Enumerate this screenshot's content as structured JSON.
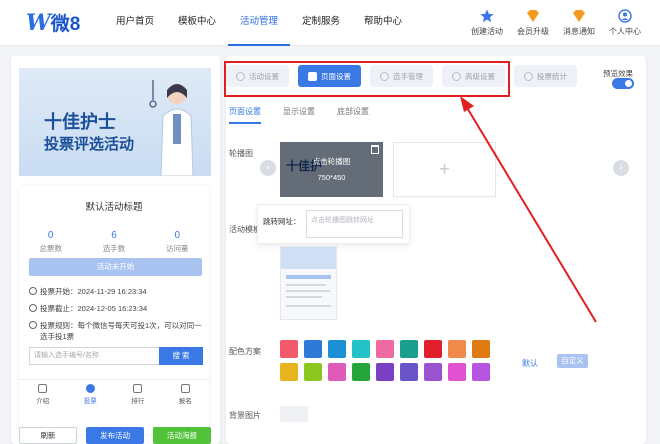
{
  "logo": {
    "text": "微8",
    "mark": "W"
  },
  "nav": {
    "items": [
      "用户首页",
      "模板中心",
      "活动管理",
      "定制服务",
      "帮助中心"
    ],
    "active": 2
  },
  "tools": [
    {
      "label": "创建活动",
      "icon": "star-icon",
      "color": "#3a78e6"
    },
    {
      "label": "会员升级",
      "icon": "vip-icon",
      "color": "#f39a1f"
    },
    {
      "label": "消息通知",
      "icon": "bell-icon",
      "color": "#f39a1f"
    },
    {
      "label": "个人中心",
      "icon": "user-icon",
      "color": "#3a78e6"
    }
  ],
  "preview": {
    "banner_line1": "十佳护士",
    "banner_line2": "投票评选活动",
    "title": "默认活动标题",
    "stats": [
      {
        "num": "0",
        "label": "总票数"
      },
      {
        "num": "6",
        "label": "选手数"
      },
      {
        "num": "0",
        "label": "访问量"
      }
    ],
    "status": "活动未开始",
    "info": [
      "投票开始：2024-11-29 16:23:34",
      "投票截止：2024-12-05 16:23:34",
      "投票规则：每个微信号每天可投1次，可以对同一选手投1票"
    ],
    "search_placeholder": "请输入选手编号/名称",
    "search_btn": "搜 索",
    "tabs": [
      "介绍",
      "投票",
      "排行",
      "报名"
    ],
    "active_tab": 1,
    "bottom_buttons": [
      "刷新",
      "发布活动",
      "活动海报"
    ]
  },
  "editor": {
    "steps": [
      "活动设置",
      "页面设置",
      "选手管理",
      "高级设置",
      "投票统计"
    ],
    "active_step": 1,
    "preview_toggle_label": "预览效果",
    "preview_toggle_on": true,
    "subtabs": [
      "页面设置",
      "显示设置",
      "底部设置"
    ],
    "active_subtab": 0,
    "labels": {
      "carousel": "轮播图",
      "activity_mode": "活动模板",
      "color_scheme": "配色方案",
      "bg_image": "背景图片"
    },
    "slide": {
      "title": "十佳护",
      "overlay_text": "点击轮播图",
      "size": "750*450"
    },
    "link": {
      "label": "跳转网址：",
      "placeholder": "点击轮播图跳转网址"
    },
    "colors": [
      "#f05a6a",
      "#2f7ad6",
      "#1c8fd6",
      "#23c1c8",
      "#ee6aa0",
      "#1a9f8c",
      "#e01f2c",
      "#f08a4b",
      "#e07a12",
      "#e6b41c",
      "#8cc61f",
      "#e05ab8",
      "#24a43a",
      "#7a3fc2",
      "#6a55c8",
      "#9a52d0",
      "#e052d0",
      "#b855e0"
    ],
    "default_label": "默认",
    "custom_label": "自定义"
  },
  "accent": "#3a78e6",
  "highlight_color": "#e0201e"
}
